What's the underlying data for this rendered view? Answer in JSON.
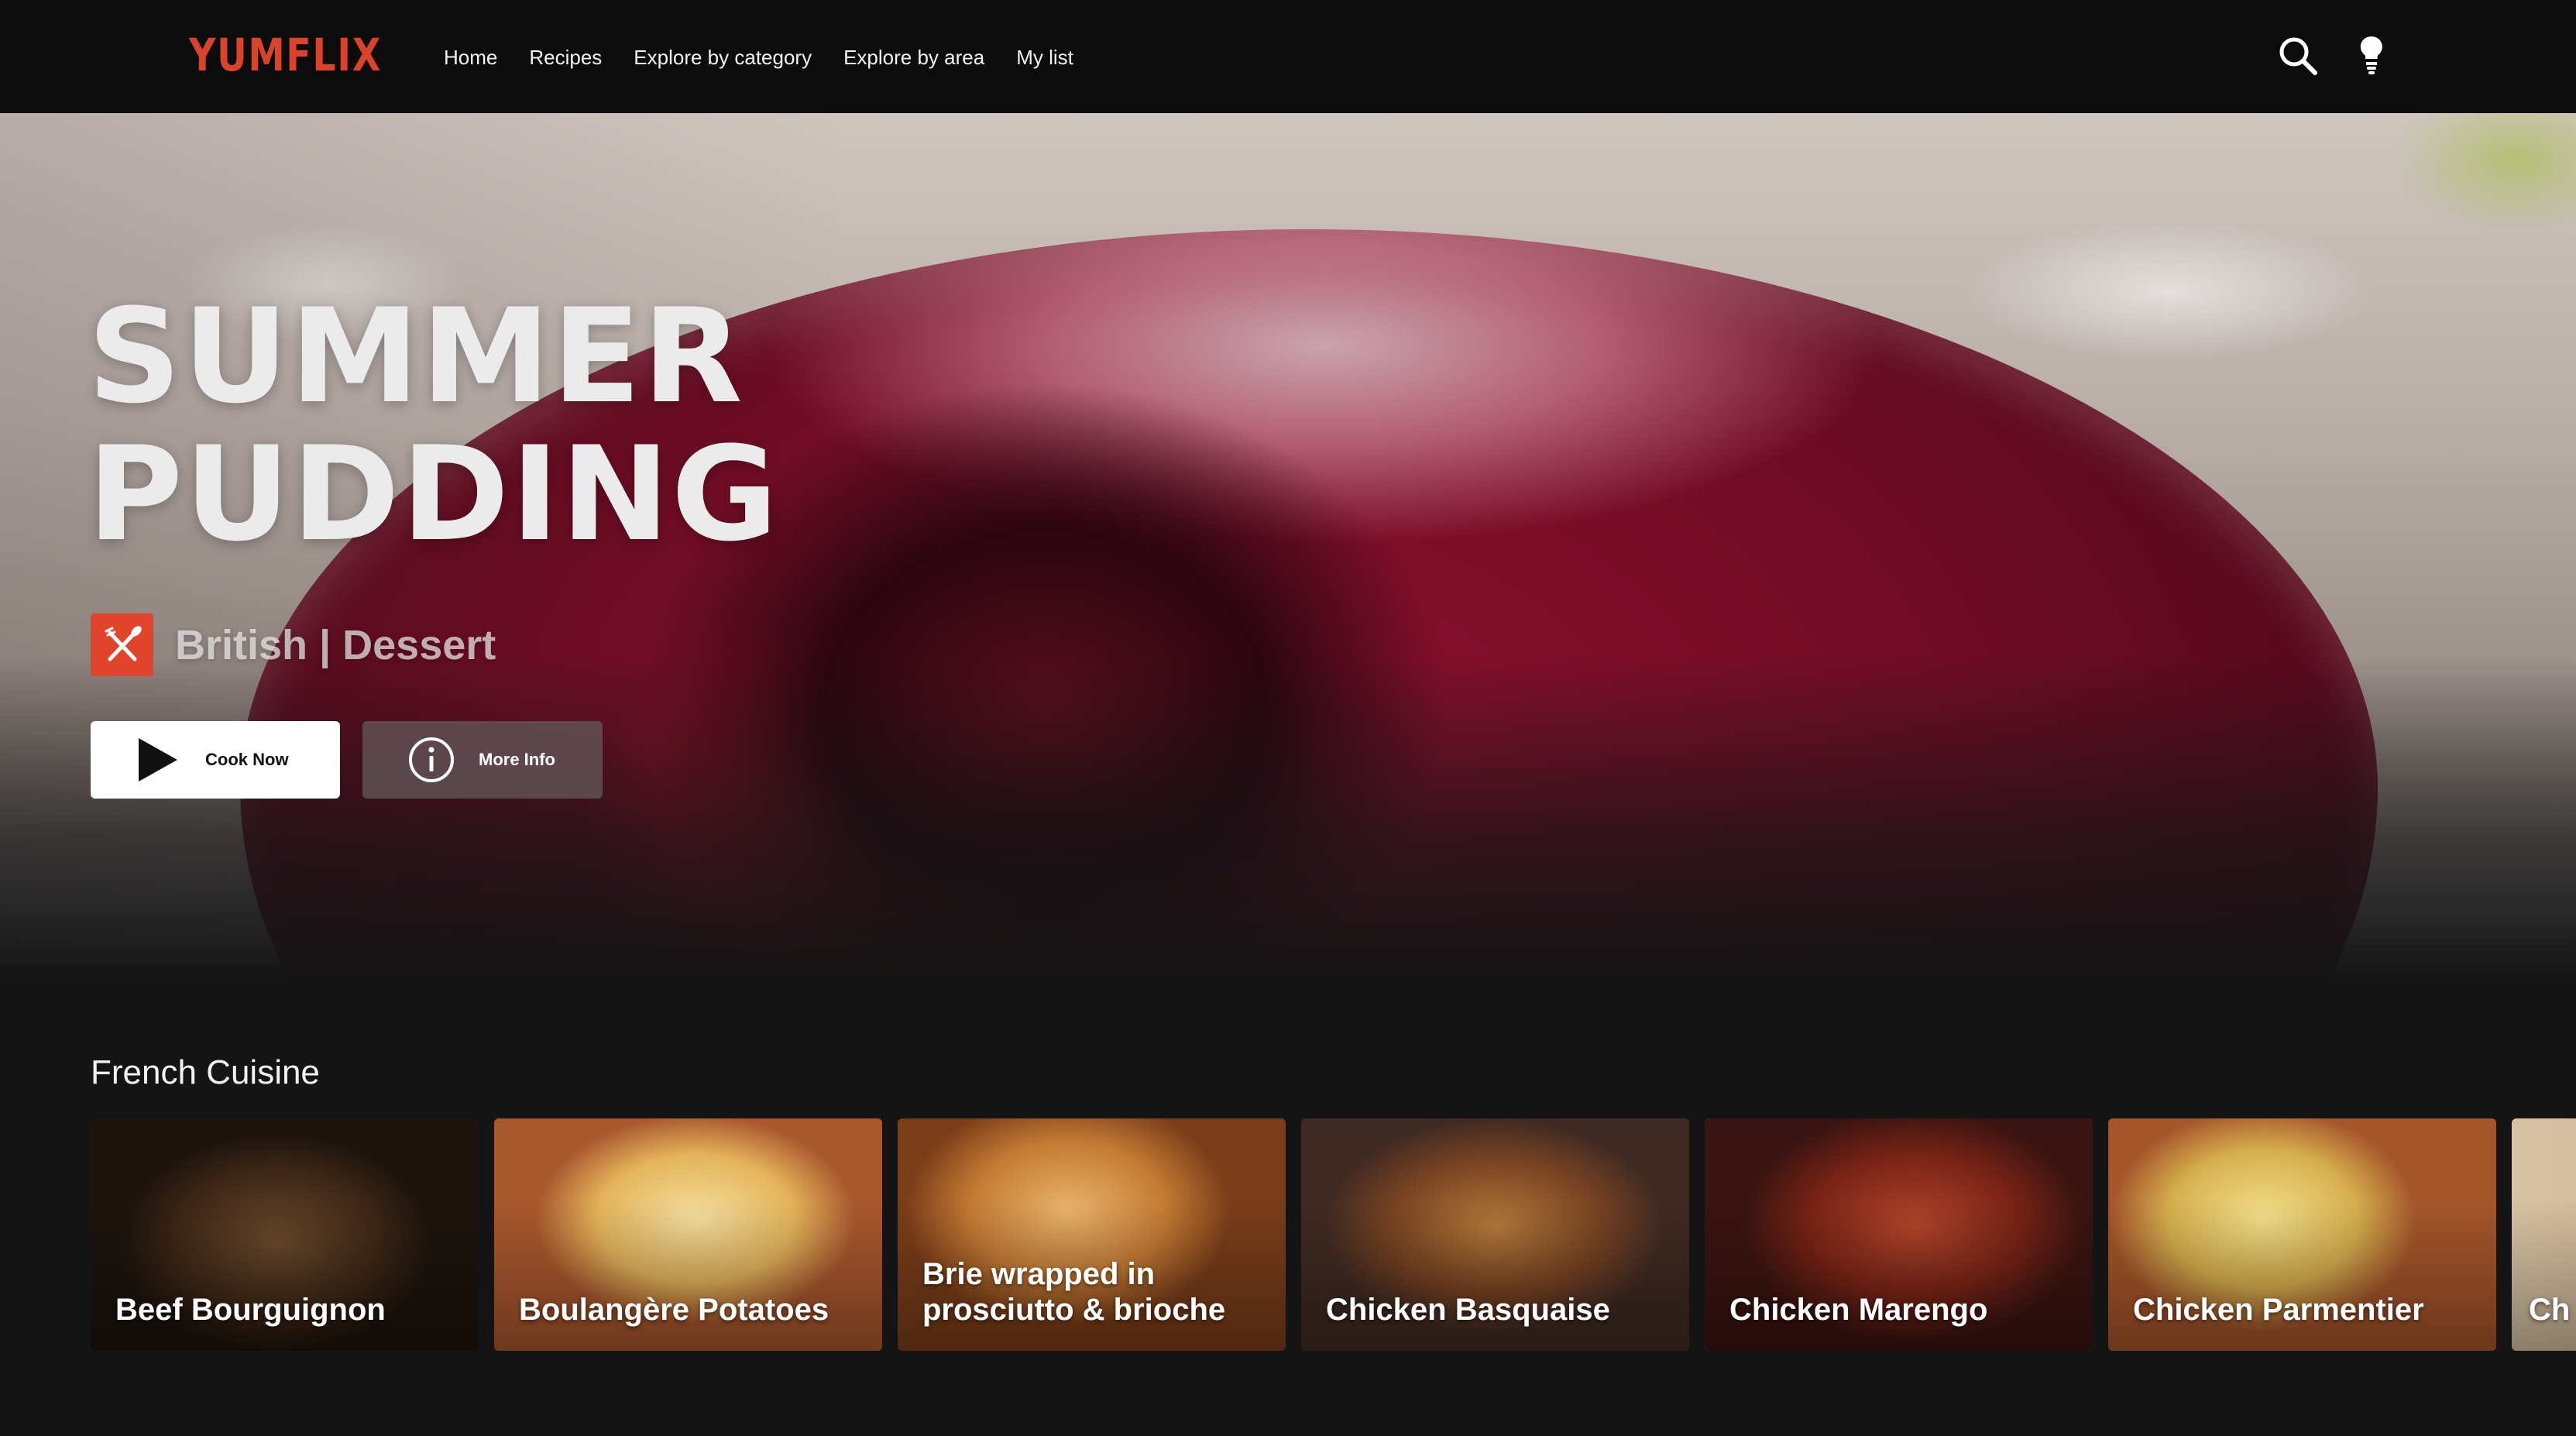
{
  "nav": {
    "logo": "YUMFLIX",
    "links": [
      "Home",
      "Recipes",
      "Explore by category",
      "Explore by area",
      "My list"
    ],
    "icons": [
      "search-icon",
      "lightbulb-icon"
    ]
  },
  "hero": {
    "title": "SUMMER PUDDING",
    "tag_icon": "fork-knife-icon",
    "tag": "British | Dessert",
    "cook_button": "Cook Now",
    "info_button": "More Info"
  },
  "row": {
    "title": "French Cuisine",
    "items": [
      {
        "title": "Beef Bourguignon"
      },
      {
        "title": "Boulangère Potatoes"
      },
      {
        "title": "Brie wrapped in prosciutto & brioche"
      },
      {
        "title": "Chicken Basquaise"
      },
      {
        "title": "Chicken Marengo"
      },
      {
        "title": "Chicken Parmentier"
      },
      {
        "title": "Ch"
      }
    ]
  },
  "colors": {
    "brand": "#d9422b",
    "background": "#141414",
    "navbar": "#0c0c0c"
  }
}
